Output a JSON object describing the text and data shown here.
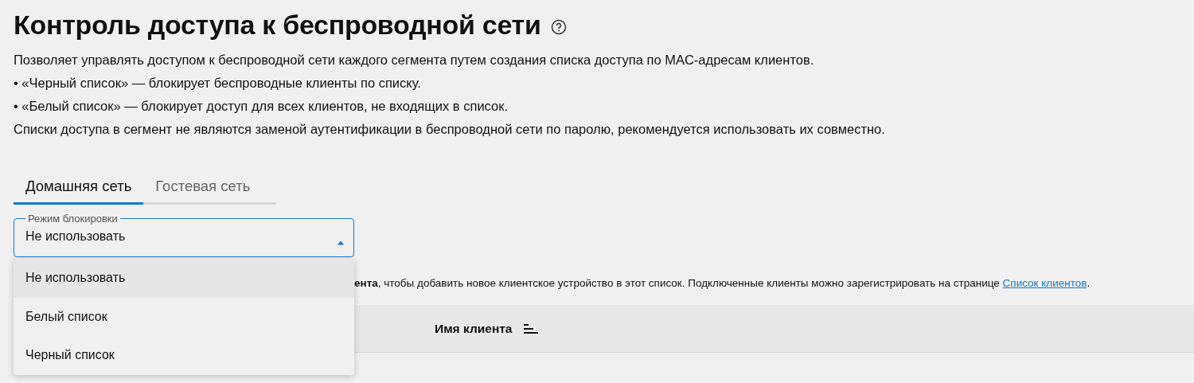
{
  "title": "Контроль доступа к беспроводной сети",
  "description": [
    "Позволяет управлять доступом к беспроводной сети каждого сегмента путем создания списка доступа по MAC-адресам клиентов.",
    "• «Черный список» — блокирует беспроводные клиенты по списку.",
    "• «Белый список» — блокирует доступ для всех клиентов, не входящих в список.",
    "Списки доступа в сегмент не являются заменой аутентификации в беспроводной сети по паролю, рекомендуется использовать их совместно."
  ],
  "tabs": [
    {
      "label": "Домашняя сеть",
      "selected": true
    },
    {
      "label": "Гостевая сеть",
      "selected": false
    }
  ],
  "block_mode": {
    "label": "Режим блокировки",
    "value": "Не использовать",
    "expanded": true,
    "options": [
      {
        "label": "Не использовать",
        "selected": true
      },
      {
        "label": "Белый список",
        "selected": false
      },
      {
        "label": "Черный список",
        "selected": false
      }
    ]
  },
  "notice": {
    "text": "**ента**, чтобы добавить новое клиентское устройство в этот список. Подключенные клиенты можно зарегистрировать на странице ",
    "link": "Список клиентов",
    "tail": "."
  },
  "table": {
    "columns": [
      "Имя клиента"
    ]
  }
}
